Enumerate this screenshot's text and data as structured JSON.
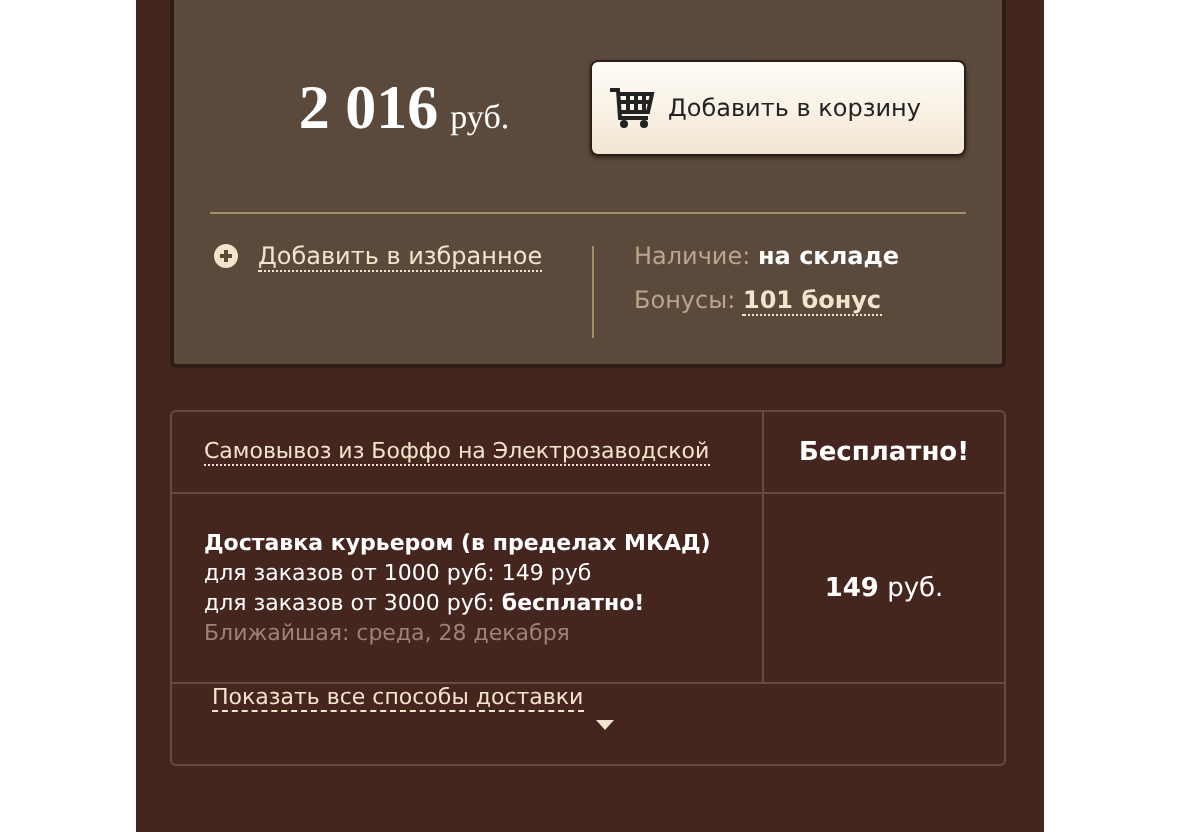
{
  "offer": {
    "price": "2 016",
    "currency": "руб.",
    "cart_button": "Добавить в корзину",
    "favorite_link": "Добавить в избранное",
    "availability_label": "Наличие:",
    "availability_value": "на складе",
    "bonus_label": "Бонусы:",
    "bonus_value": "101 бонус"
  },
  "delivery": {
    "options": [
      {
        "kind": "link",
        "name": "Самовывоз из Боффо на Электрозаводской",
        "price": "Бесплатно!"
      },
      {
        "kind": "details",
        "name": "Доставка курьером (в пределах МКАД)",
        "lines": [
          "для заказов от 1000 руб: 149 руб",
          "для заказов от 3000 руб: **бесплатно!**"
        ],
        "note": "Ближайшая: среда, 28 декабря",
        "price": "**149** руб."
      }
    ],
    "show_all_link": "Показать все способы доставки"
  }
}
